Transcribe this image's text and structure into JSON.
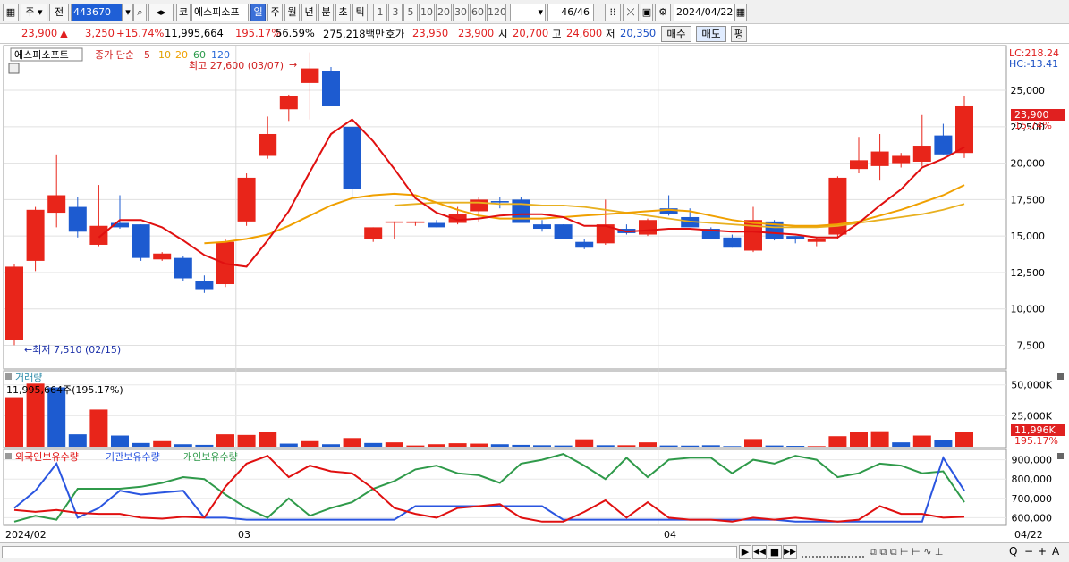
{
  "toolbar": {
    "period_select": "주",
    "range_select": "전",
    "stock_code": "443670",
    "market_label": "코",
    "stock_name": "에스피소프",
    "periods": [
      "일",
      "주",
      "월",
      "년",
      "분",
      "초",
      "틱"
    ],
    "active_period": "일",
    "intervals": [
      "1",
      "3",
      "5",
      "10",
      "20",
      "30",
      "60",
      "120"
    ],
    "count": "46/46",
    "date": "2024/04/22"
  },
  "quote": {
    "price": "23,900",
    "change": "3,250",
    "change_pct": "+15.74%",
    "volume": "11,995,664",
    "volume_ratio": "195.17%",
    "turnover": "56.59%",
    "amount": "275,218백만",
    "ask_label": "호가",
    "ask": "23,950",
    "bid": "23,900",
    "open_label": "시",
    "open": "20,700",
    "high_label": "고",
    "high": "24,600",
    "low_label": "저",
    "low": "20,350",
    "buy_button": "매수",
    "sell_button": "매도",
    "eval_button": "평"
  },
  "colors": {
    "up": "#e8251a",
    "down": "#1d5bd0",
    "ma5": "#e01010",
    "ma20": "#f0a000",
    "ma60": "#e8b020",
    "foreign": "#e01010",
    "institution": "#2a55e0",
    "individual": "#2f9a4a"
  },
  "chart_data": [
    {
      "type": "candlestick",
      "legend": {
        "name": "에스피소프트",
        "series": "종가 단순",
        "periods": [
          "5",
          "10",
          "20",
          "60",
          "120"
        ]
      },
      "annotations": {
        "max": "최고 27,600 (03/07)",
        "min": "최저 7,510 (02/15)"
      },
      "lc": "LC:218.24",
      "hc": "HC:-13.41",
      "last_price": "23,900",
      "last_pct": "15.74%",
      "yticks": [
        7500,
        10000,
        12500,
        15000,
        17500,
        20000,
        22500,
        25000
      ],
      "ylim": [
        6000,
        27700
      ],
      "x_labels": [
        "2024/02",
        "03",
        "04",
        "04/22"
      ],
      "candles": [
        {
          "o": 7900,
          "h": 13100,
          "l": 7510,
          "c": 12900
        },
        {
          "o": 13300,
          "h": 17000,
          "l": 12600,
          "c": 16800
        },
        {
          "o": 16600,
          "h": 20600,
          "l": 15600,
          "c": 17800
        },
        {
          "o": 17000,
          "h": 17700,
          "l": 14900,
          "c": 15300
        },
        {
          "o": 14400,
          "h": 18500,
          "l": 14300,
          "c": 15700
        },
        {
          "o": 15900,
          "h": 17800,
          "l": 15500,
          "c": 15600
        },
        {
          "o": 15800,
          "h": 15800,
          "l": 13300,
          "c": 13500
        },
        {
          "o": 13400,
          "h": 13900,
          "l": 13300,
          "c": 13800
        },
        {
          "o": 13500,
          "h": 13600,
          "l": 11900,
          "c": 12100
        },
        {
          "o": 11900,
          "h": 12300,
          "l": 11100,
          "c": 11300
        },
        {
          "o": 11700,
          "h": 14800,
          "l": 11500,
          "c": 14600
        },
        {
          "o": 16000,
          "h": 19300,
          "l": 15700,
          "c": 19000
        },
        {
          "o": 20500,
          "h": 23200,
          "l": 20300,
          "c": 22000
        },
        {
          "o": 23700,
          "h": 24700,
          "l": 22900,
          "c": 24600
        },
        {
          "o": 25500,
          "h": 27600,
          "l": 23000,
          "c": 26500
        },
        {
          "o": 26300,
          "h": 26600,
          "l": 24100,
          "c": 23900
        },
        {
          "o": 22500,
          "h": 22500,
          "l": 17700,
          "c": 18200
        },
        {
          "o": 14800,
          "h": 15600,
          "l": 14600,
          "c": 15600
        },
        {
          "o": 16000,
          "h": 16000,
          "l": 14800,
          "c": 16000
        },
        {
          "o": 15900,
          "h": 16000,
          "l": 15700,
          "c": 16000
        },
        {
          "o": 15900,
          "h": 16100,
          "l": 15600,
          "c": 15600
        },
        {
          "o": 15900,
          "h": 17000,
          "l": 15800,
          "c": 16500
        },
        {
          "o": 16700,
          "h": 17700,
          "l": 16000,
          "c": 17500
        },
        {
          "o": 17400,
          "h": 17700,
          "l": 16900,
          "c": 17300
        },
        {
          "o": 17500,
          "h": 17700,
          "l": 15900,
          "c": 15900
        },
        {
          "o": 15800,
          "h": 16100,
          "l": 15300,
          "c": 15500
        },
        {
          "o": 15800,
          "h": 15800,
          "l": 14800,
          "c": 14800
        },
        {
          "o": 14600,
          "h": 14800,
          "l": 14100,
          "c": 14200
        },
        {
          "o": 14500,
          "h": 17500,
          "l": 14400,
          "c": 15800
        },
        {
          "o": 15500,
          "h": 15800,
          "l": 15100,
          "c": 15200
        },
        {
          "o": 15100,
          "h": 16200,
          "l": 15000,
          "c": 16100
        },
        {
          "o": 16900,
          "h": 17800,
          "l": 16400,
          "c": 16500
        },
        {
          "o": 16300,
          "h": 16900,
          "l": 15700,
          "c": 15600
        },
        {
          "o": 15500,
          "h": 15600,
          "l": 14800,
          "c": 14800
        },
        {
          "o": 14900,
          "h": 15100,
          "l": 14200,
          "c": 14200
        },
        {
          "o": 14000,
          "h": 17000,
          "l": 13900,
          "c": 16100
        },
        {
          "o": 16000,
          "h": 16100,
          "l": 14700,
          "c": 14800
        },
        {
          "o": 15000,
          "h": 15000,
          "l": 14500,
          "c": 14800
        },
        {
          "o": 14600,
          "h": 14900,
          "l": 14300,
          "c": 14800
        },
        {
          "o": 15100,
          "h": 19100,
          "l": 14800,
          "c": 19000
        },
        {
          "o": 19600,
          "h": 21800,
          "l": 19300,
          "c": 20200
        },
        {
          "o": 19800,
          "h": 22000,
          "l": 18800,
          "c": 20800
        },
        {
          "o": 20000,
          "h": 20700,
          "l": 19700,
          "c": 20500
        },
        {
          "o": 20100,
          "h": 23300,
          "l": 19800,
          "c": 21200
        },
        {
          "o": 21900,
          "h": 22700,
          "l": 20600,
          "c": 20600
        },
        {
          "o": 20700,
          "h": 24600,
          "l": 20350,
          "c": 23900
        }
      ],
      "ma5": [
        null,
        null,
        null,
        null,
        14900,
        16100,
        16100,
        15600,
        14700,
        13700,
        13100,
        12900,
        14700,
        16700,
        19400,
        22000,
        23000,
        21500,
        19600,
        17600,
        16600,
        16100,
        16200,
        16400,
        16500,
        16500,
        16300,
        15700,
        15700,
        15300,
        15400,
        15500,
        15500,
        15400,
        15300,
        15300,
        15200,
        15100,
        14900,
        14900,
        15900,
        17100,
        18200,
        19700,
        20300,
        21100
      ],
      "ma20": [
        null,
        null,
        null,
        null,
        null,
        null,
        null,
        null,
        null,
        14500,
        14600,
        14800,
        15100,
        15700,
        16400,
        17100,
        17600,
        17800,
        17900,
        17800,
        17300,
        16800,
        16400,
        16200,
        16200,
        16200,
        16300,
        16400,
        16500,
        16600,
        16700,
        16800,
        16700,
        16400,
        16100,
        15900,
        15800,
        15700,
        15700,
        15800,
        16000,
        16400,
        16800,
        17300,
        17800,
        18500
      ],
      "ma60": [
        null,
        null,
        null,
        null,
        null,
        null,
        null,
        null,
        null,
        null,
        null,
        null,
        null,
        null,
        null,
        null,
        null,
        null,
        17100,
        17200,
        17300,
        17300,
        17300,
        17200,
        17200,
        17100,
        17100,
        17000,
        16800,
        16600,
        16400,
        16200,
        16000,
        15900,
        15800,
        15700,
        15600,
        15600,
        15600,
        15700,
        15900,
        16100,
        16300,
        16500,
        16800,
        17200
      ]
    },
    {
      "type": "bar",
      "title": "거래량",
      "current_label": "11,995,664주(195.17%)",
      "yticks_label": [
        "50,000K",
        "25,000K"
      ],
      "yticks": [
        50000,
        25000
      ],
      "ylim": [
        0,
        57000
      ],
      "last_label": "11,996K",
      "last_pct": "195.17%",
      "values": [
        40000,
        51000,
        48000,
        10000,
        30000,
        9000,
        3000,
        4500,
        2000,
        1500,
        10000,
        9500,
        12000,
        2500,
        4500,
        2000,
        7000,
        3000,
        3500,
        1000,
        2000,
        2800,
        2500,
        2000,
        1500,
        1200,
        1000,
        6000,
        1200,
        1200,
        3500,
        1000,
        900,
        1200,
        500,
        6200,
        1000,
        700,
        500,
        8500,
        12000,
        12500,
        3500,
        9000,
        5500,
        12000
      ],
      "up": [
        1,
        1,
        0,
        0,
        1,
        0,
        0,
        1,
        0,
        0,
        1,
        1,
        1,
        0,
        1,
        0,
        1,
        0,
        1,
        1,
        1,
        1,
        1,
        0,
        0,
        0,
        0,
        1,
        0,
        1,
        1,
        0,
        0,
        0,
        0,
        1,
        0,
        0,
        1,
        1,
        1,
        1,
        0,
        1,
        0,
        1
      ]
    },
    {
      "type": "line",
      "legend": [
        "외국인보유수량",
        "기관보유수량",
        "개인보유수량"
      ],
      "yticks_label": [
        "900,000",
        "800,000",
        "700,000",
        "600,000"
      ],
      "yticks": [
        900000,
        800000,
        700000,
        600000
      ],
      "ylim": [
        565000,
        935000
      ],
      "foreign": [
        640000,
        630000,
        640000,
        625000,
        620000,
        620000,
        600000,
        595000,
        605000,
        600000,
        760000,
        880000,
        920000,
        810000,
        870000,
        840000,
        830000,
        750000,
        650000,
        620000,
        600000,
        650000,
        660000,
        670000,
        600000,
        580000,
        580000,
        630000,
        690000,
        600000,
        680000,
        600000,
        590000,
        590000,
        580000,
        600000,
        590000,
        600000,
        590000,
        580000,
        590000,
        660000,
        620000,
        620000,
        600000,
        605000
      ],
      "institution": [
        650000,
        740000,
        880000,
        600000,
        650000,
        740000,
        720000,
        730000,
        740000,
        600000,
        600000,
        590000,
        590000,
        590000,
        590000,
        590000,
        590000,
        590000,
        590000,
        660000,
        660000,
        660000,
        660000,
        660000,
        660000,
        660000,
        590000,
        590000,
        590000,
        590000,
        590000,
        590000,
        590000,
        590000,
        590000,
        590000,
        590000,
        580000,
        580000,
        580000,
        580000,
        580000,
        580000,
        580000,
        910000,
        740000
      ],
      "individual": [
        580000,
        610000,
        590000,
        750000,
        750000,
        750000,
        760000,
        780000,
        810000,
        800000,
        720000,
        650000,
        600000,
        700000,
        610000,
        650000,
        680000,
        750000,
        790000,
        850000,
        870000,
        830000,
        820000,
        780000,
        880000,
        900000,
        930000,
        870000,
        800000,
        910000,
        810000,
        900000,
        910000,
        910000,
        830000,
        900000,
        880000,
        920000,
        900000,
        810000,
        830000,
        880000,
        870000,
        830000,
        840000,
        680000
      ]
    }
  ],
  "nav": {
    "scroll_right": "▶",
    "first": "◀◀",
    "stop": "■",
    "next": "▶▶",
    "zoom_out": "−",
    "zoom_in": "+",
    "text_tool": "A",
    "search": "Q"
  }
}
